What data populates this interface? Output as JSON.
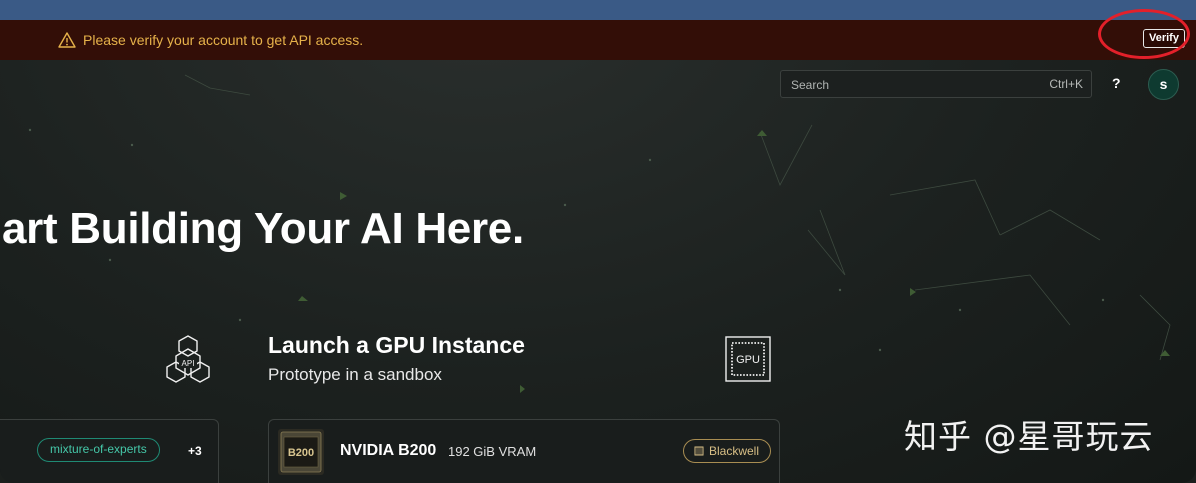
{
  "banner": {
    "warning_text": "Please verify your account to get API access.",
    "verify_label": "Verify",
    "warning_icon": "warning-triangle-icon",
    "annotation_color": "#e3202a"
  },
  "header": {
    "search_placeholder": "Search",
    "search_shortcut": "Ctrl+K",
    "help_label": "?",
    "avatar_initial": "s"
  },
  "hero": {
    "title": "art Building Your AI Here."
  },
  "section": {
    "title": "Launch a GPU Instance",
    "subtitle": "Prototype in a sandbox",
    "api_icon_label": "API",
    "gpu_icon_label": "GPU"
  },
  "model_card": {
    "tag": "mixture-of-experts",
    "more_count": "+3",
    "accent": "#45c7a8"
  },
  "gpu_card": {
    "chip_label": "B200",
    "name": "NVIDIA B200",
    "vram": "192 GiB VRAM",
    "architecture": "Blackwell",
    "badge_color": "#a88d52"
  },
  "watermark": "知乎 @星哥玩云"
}
